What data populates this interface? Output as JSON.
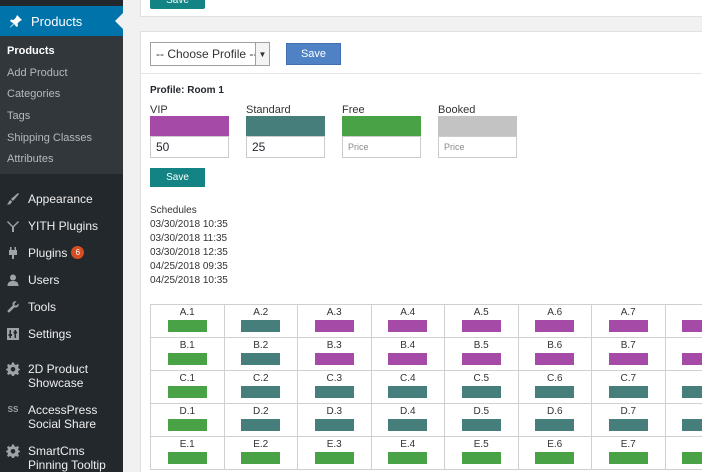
{
  "colors": {
    "vip": "#a64aa8",
    "standard": "#467e7b",
    "free": "#4aa246",
    "booked": "#c3c3c3",
    "accent": "#0073aa",
    "button_teal": "#138383",
    "button_blue": "#4f82c4"
  },
  "sidebar": {
    "active": {
      "label": "Products",
      "icon": "pin-icon"
    },
    "submenu": [
      "Products",
      "Add Product",
      "Categories",
      "Tags",
      "Shipping Classes",
      "Attributes"
    ],
    "items": [
      {
        "label": "Appearance",
        "icon": "paintbrush-icon"
      },
      {
        "label": "YITH Plugins",
        "icon": "yith-icon"
      },
      {
        "label": "Plugins",
        "icon": "plug-icon",
        "badge": "6"
      },
      {
        "label": "Users",
        "icon": "user-icon"
      },
      {
        "label": "Tools",
        "icon": "wrench-icon"
      },
      {
        "label": "Settings",
        "icon": "settings-icon"
      },
      {
        "label": "2D Product Showcase",
        "icon": "gear-icon"
      },
      {
        "label": "AccessPress Social Share",
        "icon": "ss-icon"
      },
      {
        "label": "SmartCms Pinning Tooltip",
        "icon": "gear-icon"
      }
    ]
  },
  "top_panel": {
    "save_label": "Save"
  },
  "toolbar": {
    "select_value": "-- Choose Profile --",
    "save_label": "Save"
  },
  "profile": {
    "title": "Profile: Room 1",
    "legend": [
      {
        "label": "VIP",
        "value": "50",
        "placeholder": "Price",
        "color_key": "vip"
      },
      {
        "label": "Standard",
        "value": "25",
        "placeholder": "Price",
        "color_key": "standard"
      },
      {
        "label": "Free",
        "value": "",
        "placeholder": "Price",
        "color_key": "free"
      },
      {
        "label": "Booked",
        "value": "",
        "placeholder": "Price",
        "color_key": "booked"
      }
    ],
    "save_label": "Save"
  },
  "schedules": {
    "title": "Schedules",
    "items": [
      "03/30/2018 10:35",
      "03/30/2018 11:35",
      "03/30/2018 12:35",
      "04/25/2018 09:35",
      "04/25/2018 10:35"
    ]
  },
  "seats": {
    "rows": [
      {
        "cells": [
          {
            "label": "A.1",
            "type": "free"
          },
          {
            "label": "A.2",
            "type": "standard"
          },
          {
            "label": "A.3",
            "type": "vip"
          },
          {
            "label": "A.4",
            "type": "vip"
          },
          {
            "label": "A.5",
            "type": "vip"
          },
          {
            "label": "A.6",
            "type": "vip"
          },
          {
            "label": "A.7",
            "type": "vip"
          },
          {
            "label": "",
            "type": "vip"
          }
        ]
      },
      {
        "cells": [
          {
            "label": "B.1",
            "type": "free"
          },
          {
            "label": "B.2",
            "type": "standard"
          },
          {
            "label": "B.3",
            "type": "vip"
          },
          {
            "label": "B.4",
            "type": "vip"
          },
          {
            "label": "B.5",
            "type": "vip"
          },
          {
            "label": "B.6",
            "type": "vip"
          },
          {
            "label": "B.7",
            "type": "vip"
          },
          {
            "label": "",
            "type": "vip"
          }
        ]
      },
      {
        "cells": [
          {
            "label": "C.1",
            "type": "free"
          },
          {
            "label": "C.2",
            "type": "standard"
          },
          {
            "label": "C.3",
            "type": "standard"
          },
          {
            "label": "C.4",
            "type": "standard"
          },
          {
            "label": "C.5",
            "type": "standard"
          },
          {
            "label": "C.6",
            "type": "standard"
          },
          {
            "label": "C.7",
            "type": "standard"
          },
          {
            "label": "",
            "type": "standard"
          }
        ]
      },
      {
        "cells": [
          {
            "label": "D.1",
            "type": "free"
          },
          {
            "label": "D.2",
            "type": "standard"
          },
          {
            "label": "D.3",
            "type": "standard"
          },
          {
            "label": "D.4",
            "type": "standard"
          },
          {
            "label": "D.5",
            "type": "standard"
          },
          {
            "label": "D.6",
            "type": "standard"
          },
          {
            "label": "D.7",
            "type": "standard"
          },
          {
            "label": "",
            "type": "standard"
          }
        ]
      },
      {
        "cells": [
          {
            "label": "E.1",
            "type": "free"
          },
          {
            "label": "E.2",
            "type": "free"
          },
          {
            "label": "E.3",
            "type": "free"
          },
          {
            "label": "E.4",
            "type": "free"
          },
          {
            "label": "E.5",
            "type": "free"
          },
          {
            "label": "E.6",
            "type": "free"
          },
          {
            "label": "E.7",
            "type": "free"
          },
          {
            "label": "",
            "type": "free"
          }
        ]
      }
    ]
  }
}
